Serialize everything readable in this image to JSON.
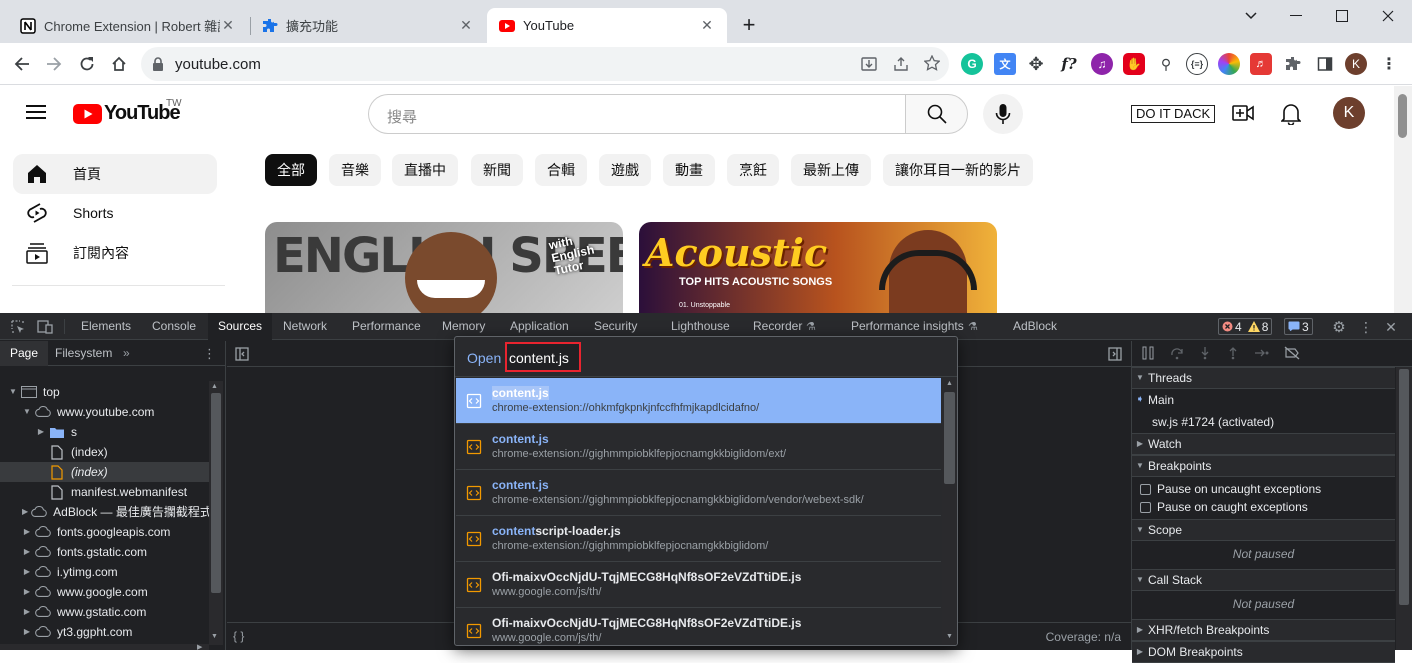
{
  "browser": {
    "tabs": [
      {
        "title": "Chrome Extension | Robert 雜記",
        "icon": "notion-icon"
      },
      {
        "title": "擴充功能",
        "icon": "puzzle-icon"
      },
      {
        "title": "YouTube",
        "icon": "youtube-icon"
      }
    ],
    "new_tab": "+",
    "url": "youtube.com"
  },
  "youtube": {
    "logo": "YouTube",
    "region": "TW",
    "search_placeholder": "搜尋",
    "extension_button": "DO IT DACK",
    "avatar_letter": "K",
    "sidebar": [
      {
        "label": "首頁",
        "icon": "home-icon"
      },
      {
        "label": "Shorts",
        "icon": "shorts-icon"
      },
      {
        "label": "訂閱內容",
        "icon": "subscriptions-icon"
      }
    ],
    "chips": [
      "全部",
      "音樂",
      "直播中",
      "新聞",
      "合輯",
      "遊戲",
      "動畫",
      "烹飪",
      "最新上傳",
      "讓你耳目一新的影片"
    ],
    "thumbnails": [
      {
        "text": "ENGLISH SPEECH",
        "badge": "with English Tutor"
      },
      {
        "text": "Acoustic",
        "sub": "TOP HITS ACOUSTIC SONGS",
        "track": "01. Unstoppable"
      }
    ]
  },
  "devtools": {
    "tabs": [
      "Elements",
      "Console",
      "Sources",
      "Network",
      "Performance",
      "Memory",
      "Application",
      "Security",
      "Lighthouse",
      "Recorder",
      "Performance insights",
      "AdBlock"
    ],
    "active_tab": "Sources",
    "errors": "4",
    "warnings": "8",
    "messages": "3",
    "navigator": {
      "tabs": [
        "Page",
        "Filesystem"
      ],
      "tree": [
        {
          "label": "top",
          "level": 0,
          "arrow": "▼",
          "icon": "frame-icon"
        },
        {
          "label": "www.youtube.com",
          "level": 1,
          "arrow": "▼",
          "icon": "cloud-icon"
        },
        {
          "label": "s",
          "level": 2,
          "arrow": "▶",
          "icon": "folder-icon"
        },
        {
          "label": "(index)",
          "level": 2,
          "arrow": "",
          "icon": "file-icon"
        },
        {
          "label": "(index)",
          "level": 2,
          "arrow": "",
          "icon": "file-orange-icon",
          "selected": true
        },
        {
          "label": "manifest.webmanifest",
          "level": 2,
          "arrow": "",
          "icon": "file-icon"
        },
        {
          "label": "AdBlock — 最佳廣告攔截程式",
          "level": 1,
          "arrow": "▶",
          "icon": "cloud-icon"
        },
        {
          "label": "fonts.googleapis.com",
          "level": 1,
          "arrow": "▶",
          "icon": "cloud-icon"
        },
        {
          "label": "fonts.gstatic.com",
          "level": 1,
          "arrow": "▶",
          "icon": "cloud-icon"
        },
        {
          "label": "i.ytimg.com",
          "level": 1,
          "arrow": "▶",
          "icon": "cloud-icon"
        },
        {
          "label": "www.google.com",
          "level": 1,
          "arrow": "▶",
          "icon": "cloud-icon"
        },
        {
          "label": "www.gstatic.com",
          "level": 1,
          "arrow": "▶",
          "icon": "cloud-icon"
        },
        {
          "label": "yt3.ggpht.com",
          "level": 1,
          "arrow": "▶",
          "icon": "cloud-icon"
        }
      ]
    },
    "coverage": "Coverage: n/a",
    "quick_open": {
      "prompt": "Open",
      "query": "content.js",
      "results": [
        {
          "hl": "content.js",
          "rest": "",
          "path": "chrome-extension://ohkmfgkpnkjnfccfhfmjkapdlcidafno/",
          "selected": true
        },
        {
          "hl": "content.js",
          "rest": "",
          "path": "chrome-extension://gighmmpiobklfepjocnamgkkbiglidom/ext/"
        },
        {
          "hl": "content.js",
          "rest": "",
          "path": "chrome-extension://gighmmpiobklfepjocnamgkkbiglidom/vendor/webext-sdk/"
        },
        {
          "hl": "content",
          "rest": "script-loader.js",
          "path": "chrome-extension://gighmmpiobklfepjocnamgkkbiglidom/"
        },
        {
          "hl": "",
          "rest": "Ofi-maixvOccNjdU-TqjMECG8HqNf8sOF2eVZdTtiDE.js",
          "path": "www.google.com/js/th/"
        },
        {
          "hl": "",
          "rest": "Ofi-maixvOccNjdU-TqjMECG8HqNf8sOF2eVZdTtiDE.js",
          "path": "www.google.com/js/th/"
        }
      ]
    },
    "debugger": {
      "threads": "Threads",
      "main": "Main",
      "sw": "sw.js #1724 (activated)",
      "watch": "Watch",
      "breakpoints": "Breakpoints",
      "pause_uncaught": "Pause on uncaught exceptions",
      "pause_caught": "Pause on caught exceptions",
      "scope": "Scope",
      "not_paused_1": "Not paused",
      "call_stack": "Call Stack",
      "not_paused_2": "Not paused",
      "xhr": "XHR/fetch Breakpoints",
      "dom": "DOM Breakpoints"
    }
  }
}
